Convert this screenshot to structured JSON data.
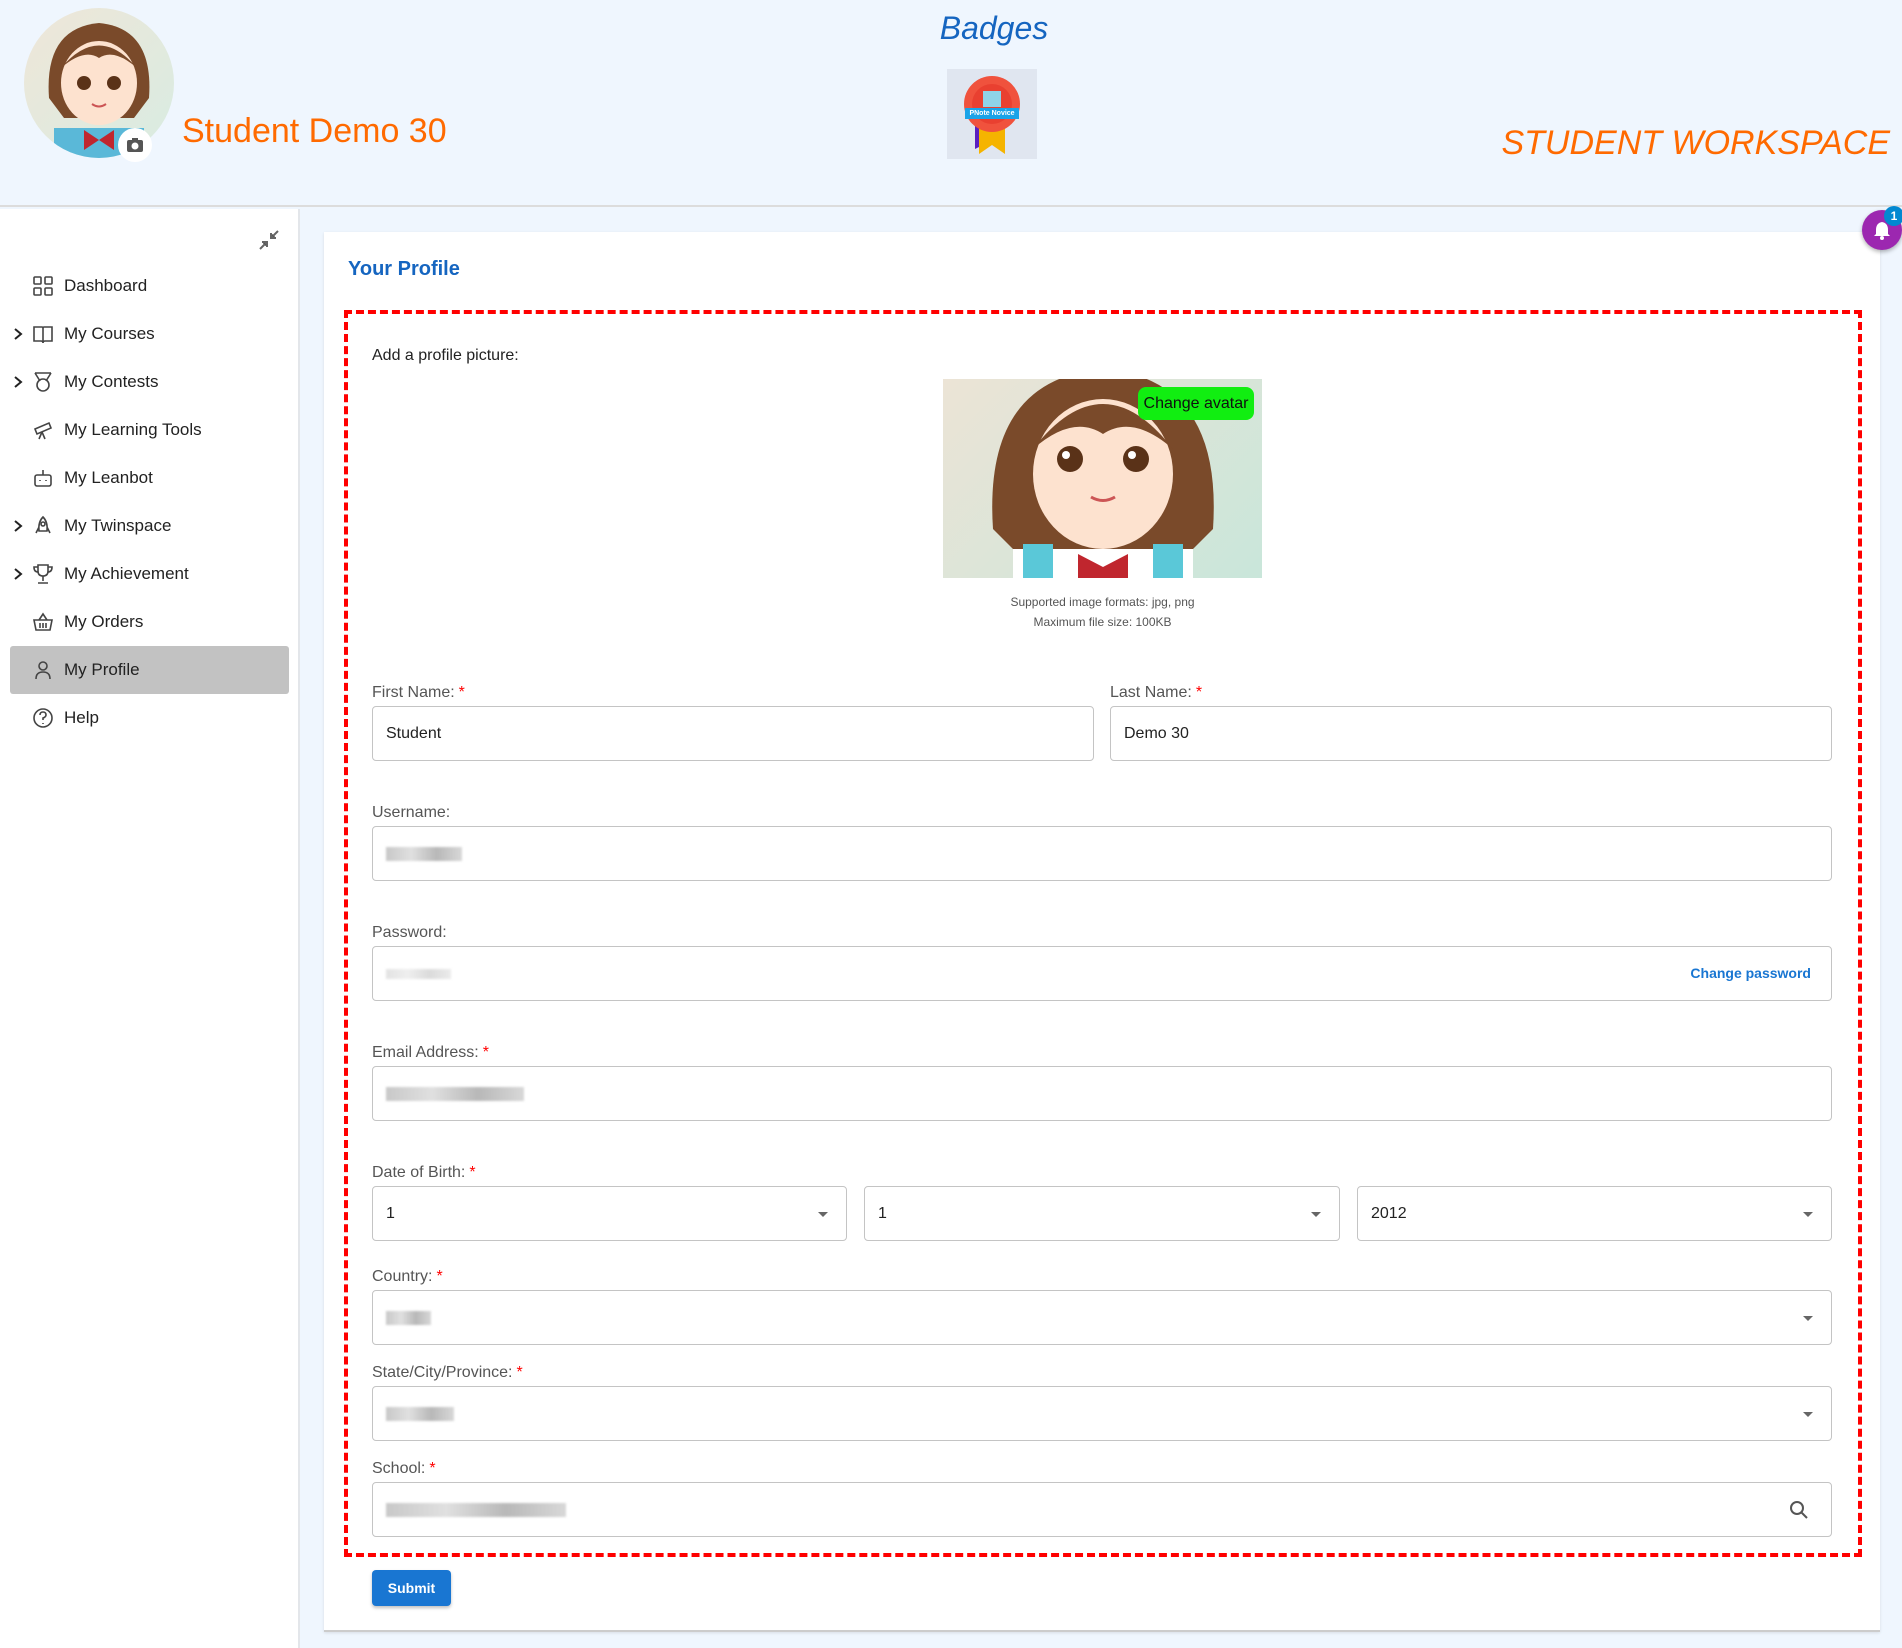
{
  "header": {
    "user_name": "Student Demo 30",
    "badges_title": "Badges",
    "badge_label": "PNote Novice",
    "workspace_title": "STUDENT WORKSPACE"
  },
  "sidebar": {
    "items": [
      {
        "label": "Dashboard",
        "icon": "grid-icon",
        "expandable": false
      },
      {
        "label": "My Courses",
        "icon": "book-icon",
        "expandable": true
      },
      {
        "label": "My Contests",
        "icon": "medal-icon",
        "expandable": true
      },
      {
        "label": "My Learning Tools",
        "icon": "telescope-icon",
        "expandable": false
      },
      {
        "label": "My Leanbot",
        "icon": "robot-icon",
        "expandable": false
      },
      {
        "label": "My Twinspace",
        "icon": "rocket-icon",
        "expandable": true
      },
      {
        "label": "My Achievement",
        "icon": "trophy-icon",
        "expandable": true
      },
      {
        "label": "My Orders",
        "icon": "basket-icon",
        "expandable": false
      },
      {
        "label": "My Profile",
        "icon": "user-icon",
        "expandable": false,
        "active": true
      },
      {
        "label": "Help",
        "icon": "help-icon",
        "expandable": false
      }
    ]
  },
  "notifications": {
    "count": "1"
  },
  "profile": {
    "title": "Your Profile",
    "picture_label": "Add a profile picture:",
    "change_avatar": "Change avatar",
    "hint_formats": "Supported image formats: jpg, png",
    "hint_size": "Maximum file size: 100KB",
    "first_name_label": "First Name:",
    "first_name": "Student",
    "last_name_label": "Last Name:",
    "last_name": "Demo 30",
    "username_label": "Username:",
    "password_label": "Password:",
    "change_password": "Change password",
    "email_label": "Email Address:",
    "dob_label": "Date of Birth:",
    "dob_day": "1",
    "dob_month": "1",
    "dob_year": "2012",
    "country_label": "Country:",
    "state_label": "State/City/Province:",
    "school_label": "School:",
    "required_mark": "*",
    "submit": "Submit"
  },
  "colors": {
    "accent": "#1565c0",
    "brand_orange": "#ff6a00",
    "required": "#ff0000",
    "change_avatar_bg": "#11ee11",
    "submit_bg": "#1976d2",
    "bell_bg": "#9c27b0"
  }
}
